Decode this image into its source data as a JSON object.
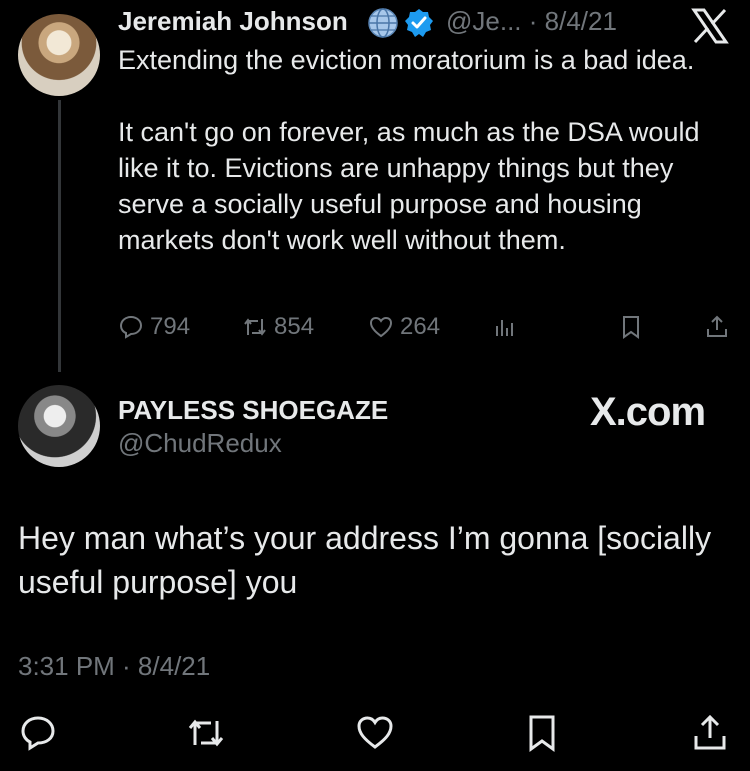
{
  "tweet": {
    "author_name": "Jeremiah Johnson",
    "handle_and_date": "@Je... · 8/4/21",
    "text": "Extending the eviction moratorium is a bad idea.\n\nIt can't go on forever, as much as the DSA would like it to. Evictions are unhappy things but they serve a socially useful purpose and housing markets don't work well without them.",
    "stats": {
      "replies": "794",
      "retweets": "854",
      "likes": "264"
    }
  },
  "reply": {
    "author_name": "PAYLESS SHOEGAZE",
    "handle": "@ChudRedux",
    "watermark": "X.com",
    "text": "Hey man what’s your address I’m gonna [socially useful purpose] you",
    "timestamp": "3:31 PM · 8/4/21"
  },
  "icons": [
    "globe-icon",
    "verified-badge-icon",
    "x-logo-icon",
    "reply-icon",
    "retweet-icon",
    "like-icon",
    "views-icon",
    "bookmark-icon",
    "share-icon"
  ],
  "colors": {
    "background": "#000000",
    "text": "#e7e9ea",
    "muted": "#71767b",
    "verified": "#1d9bf0"
  }
}
